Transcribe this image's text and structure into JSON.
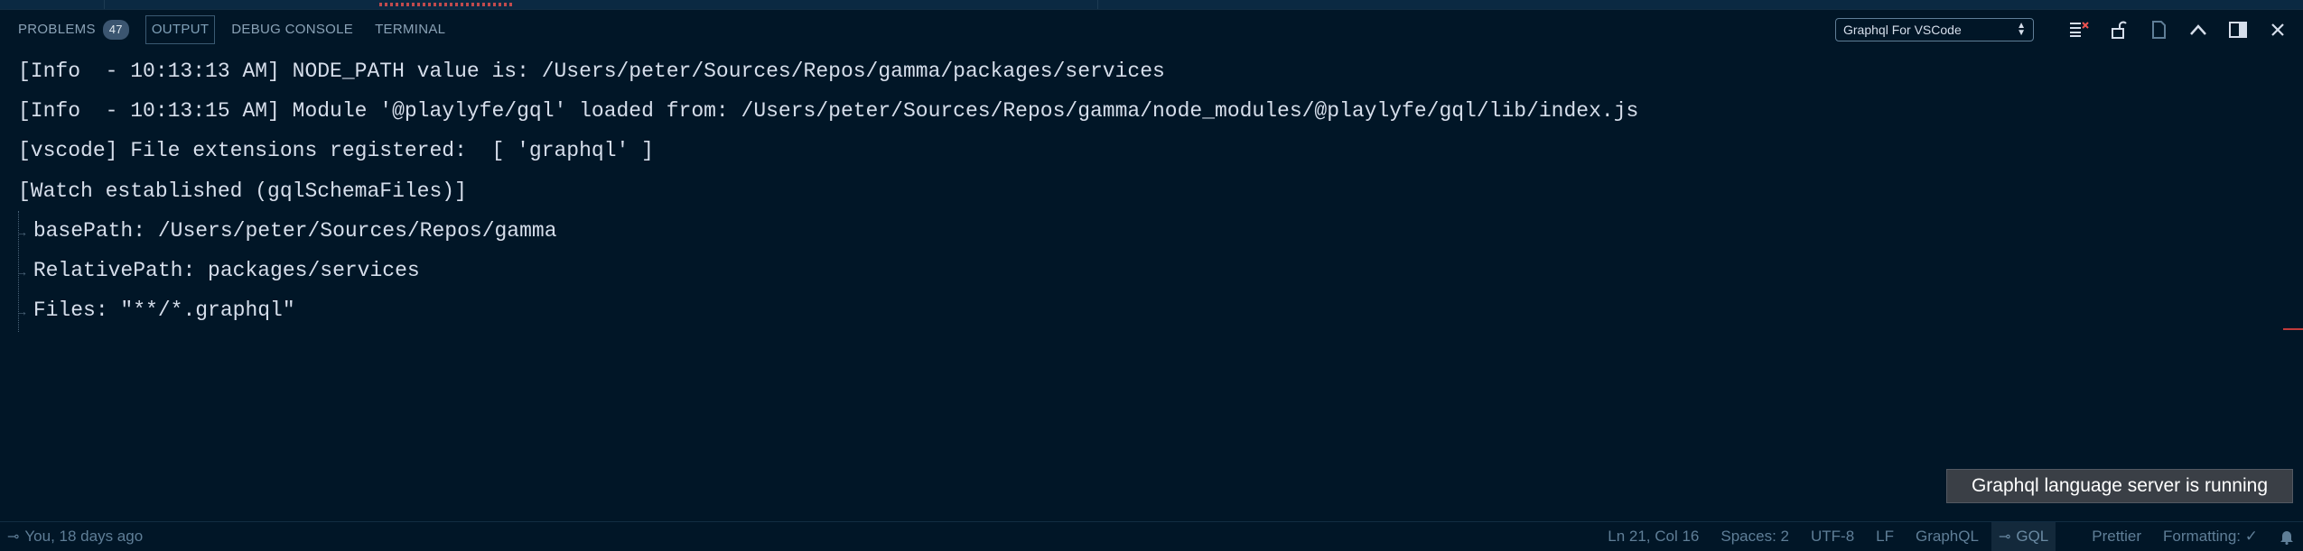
{
  "panel": {
    "tabs": [
      {
        "label": "PROBLEMS",
        "badge": "47"
      },
      {
        "label": "OUTPUT"
      },
      {
        "label": "DEBUG CONSOLE"
      },
      {
        "label": "TERMINAL"
      }
    ],
    "output_channel": "Graphql For VSCode",
    "icons": [
      "clear-output-icon",
      "lock-scroll-icon",
      "open-log-icon",
      "maximize-panel-icon",
      "panel-layout-icon",
      "close-panel-icon"
    ]
  },
  "output": {
    "lines": [
      "[Info  - 10:13:13 AM] NODE_PATH value is: /Users/peter/Sources/Repos/gamma/packages/services",
      "[Info  - 10:13:15 AM] Module '@playlyfe/gql' loaded from: /Users/peter/Sources/Repos/gamma/node_modules/@playlyfe/gql/lib/index.js",
      "[vscode] File extensions registered:  [ 'graphql' ]",
      "[Watch established (gqlSchemaFiles)]",
      "basePath: /Users/peter/Sources/Repos/gamma",
      "RelativePath: packages/services",
      "Files: \"**/*.graphql\""
    ]
  },
  "notification": "Graphql language server is running",
  "status_bar": {
    "blame": "You, 18 days ago",
    "position": "Ln 21, Col 16",
    "spaces": "Spaces: 2",
    "encoding": "UTF-8",
    "eol": "LF",
    "language": "GraphQL",
    "gql": "GQL",
    "prettier": "Prettier",
    "formatting": "Formatting: ✓"
  }
}
